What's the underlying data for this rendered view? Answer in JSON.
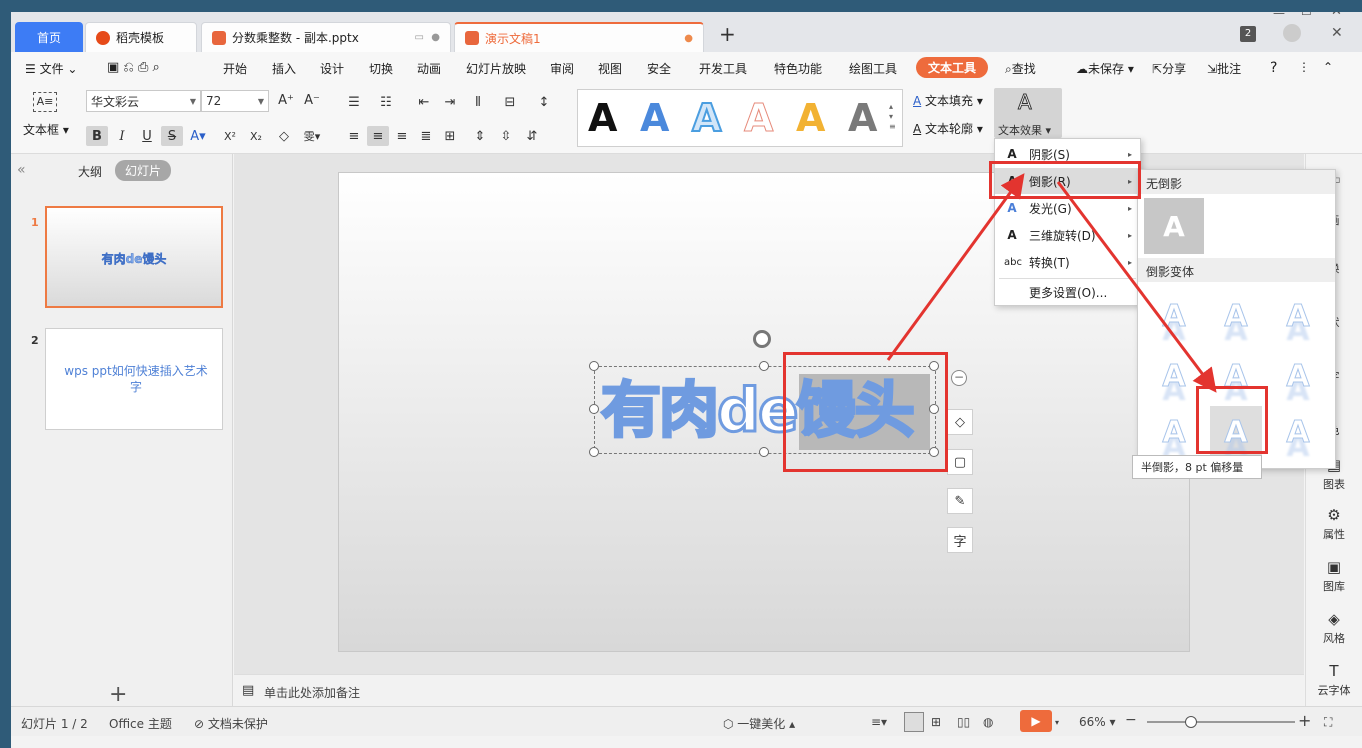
{
  "colors": {
    "accent": "#3d7cf5",
    "brand_orange": "#ee6b3c",
    "annotation_red": "#e3342f",
    "wordart_blue": "#5b8de0"
  },
  "tabs": [
    {
      "label": "首页"
    },
    {
      "label": "稻壳模板"
    },
    {
      "label": "分数乘整数 - 副本.pptx"
    },
    {
      "label": "演示文稿1"
    }
  ],
  "tab_badge": "2",
  "menu": {
    "file": "文件",
    "items": [
      "开始",
      "插入",
      "设计",
      "切换",
      "动画",
      "幻灯片放映",
      "审阅",
      "视图",
      "安全",
      "开发工具",
      "特色功能",
      "绘图工具"
    ],
    "active": "文本工具",
    "search": "查找",
    "unsaved": "未保存",
    "share": "分享",
    "annotate": "批注"
  },
  "ribbon": {
    "textbox": "文本框",
    "font_name": "华文彩云",
    "font_size": "72",
    "text_fill": "文本填充",
    "text_outline": "文本轮廓",
    "text_effect": "文本效果",
    "gallery_letter": "A"
  },
  "left_panel": {
    "outline_tab": "大纲",
    "slides_tab": "幻灯片",
    "slides": [
      {
        "number": "1",
        "text": "有肉de馒头"
      },
      {
        "number": "2",
        "text": "wps ppt如何快速插入艺术字"
      }
    ],
    "add": "+"
  },
  "slide": {
    "wordart": "有肉de馒头",
    "wordart_part1": "有肉de",
    "wordart_part2": "馒头"
  },
  "notes": "单击此处添加备注",
  "effect_menu": [
    {
      "icon": "A",
      "label": "阴影(S)"
    },
    {
      "icon": "A",
      "label": "倒影(R)"
    },
    {
      "icon": "A",
      "label": "发光(G)"
    },
    {
      "icon": "A",
      "label": "三维旋转(D)"
    },
    {
      "icon": "abc",
      "label": "转换(T)"
    },
    {
      "icon": "",
      "label": "更多设置(O)..."
    }
  ],
  "reflect_menu": {
    "none_header": "无倒影",
    "variants_header": "倒影变体",
    "letter": "A"
  },
  "tooltip": "半倒影，8 pt 偏移量",
  "right_panel": [
    "画",
    "换",
    "状",
    "字",
    "色",
    "图表",
    "属性",
    "图库",
    "风格",
    "云字体"
  ],
  "status": {
    "slide_count": "幻灯片 1 / 2",
    "theme": "Office 主题",
    "protection": "文档未保护",
    "beautify": "一键美化",
    "zoom": "66%"
  }
}
